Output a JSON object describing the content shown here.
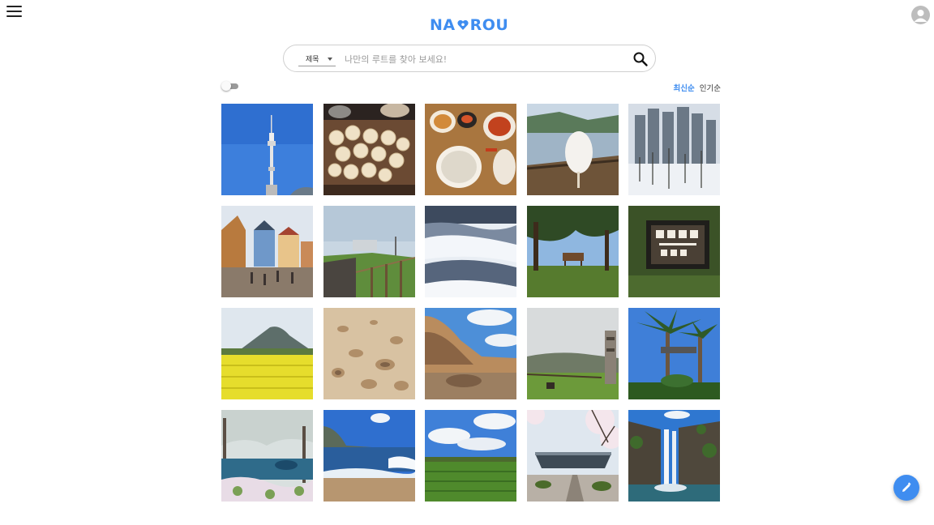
{
  "header": {
    "logo_left": "NA",
    "logo_right": "ROU"
  },
  "search": {
    "category_selected": "제목",
    "placeholder": "나만의 루트를 찾아 보세요!"
  },
  "sort": {
    "latest_label": "최신순",
    "popular_label": "인기순",
    "active": "latest"
  },
  "toggle": {
    "on": false
  },
  "colors": {
    "accent": "#3f8df0"
  },
  "icons": {
    "menu": "hamburger-menu-icon",
    "profile": "user-avatar-icon",
    "search": "search-icon",
    "fab": "pencil-icon"
  },
  "photos": [
    {
      "subject": "n-seoul-tower"
    },
    {
      "subject": "dumplings"
    },
    {
      "subject": "korean-meal-table"
    },
    {
      "subject": "cotton-candy-by-lake"
    },
    {
      "subject": "apartments-winter"
    },
    {
      "subject": "colorful-village-street"
    },
    {
      "subject": "coastal-fence-walk"
    },
    {
      "subject": "snowy-forest-aerial"
    },
    {
      "subject": "park-pavilion-trees"
    },
    {
      "subject": "arboretum-sign"
    },
    {
      "subject": "canola-field-mountain"
    },
    {
      "subject": "porous-rock-closeup"
    },
    {
      "subject": "coastal-cliff-rocks"
    },
    {
      "subject": "stone-monument-hill"
    },
    {
      "subject": "palm-trees-park"
    },
    {
      "subject": "blossom-lake"
    },
    {
      "subject": "beach-waves"
    },
    {
      "subject": "green-field-sky"
    },
    {
      "subject": "cherry-blossom-building"
    },
    {
      "subject": "waterfall-cliff"
    }
  ]
}
